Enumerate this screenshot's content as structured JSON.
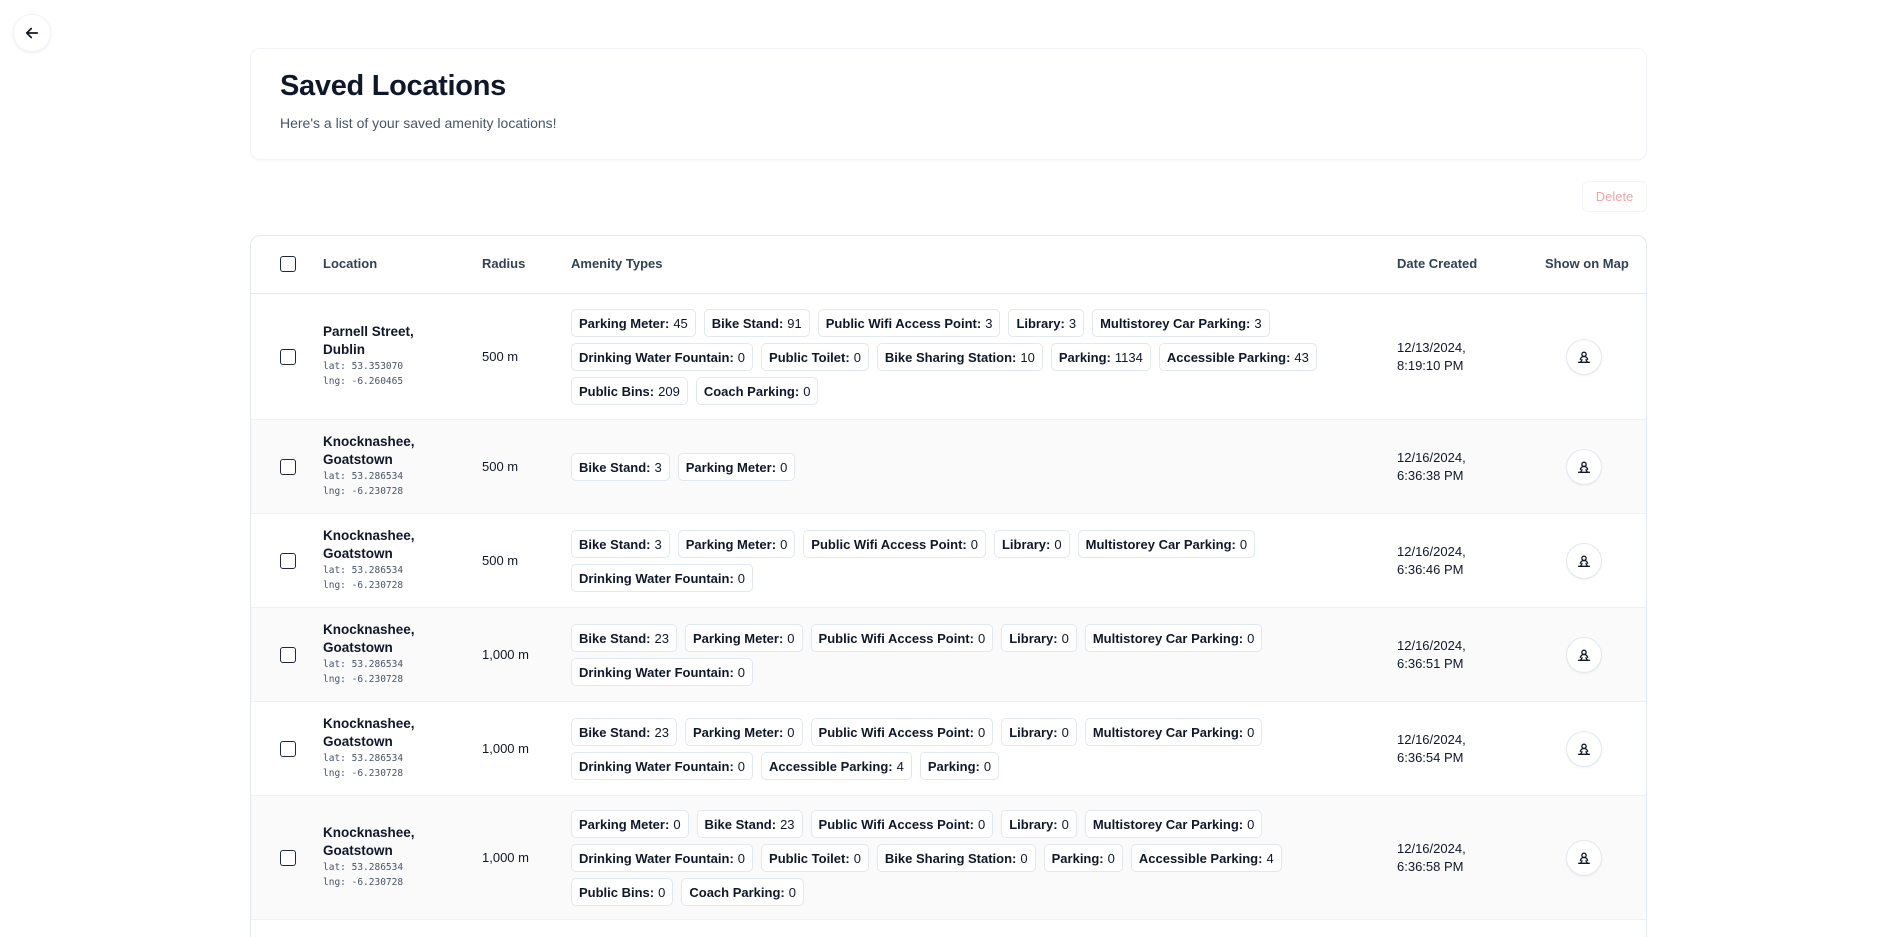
{
  "header": {
    "title": "Saved Locations",
    "subtitle": "Here's a list of your saved amenity locations!"
  },
  "actions": {
    "delete_label": "Delete"
  },
  "table": {
    "columns": [
      "Location",
      "Radius",
      "Amenity Types",
      "Date Created",
      "Show on Map"
    ],
    "rows": [
      {
        "name": "Parnell Street, Dublin",
        "lat": "lat: 53.353070",
        "lng": "lng: -6.260465",
        "radius": "500 m",
        "amenities": [
          {
            "k": "Parking Meter:",
            "v": "45"
          },
          {
            "k": "Bike Stand:",
            "v": "91"
          },
          {
            "k": "Public Wifi Access Point:",
            "v": "3"
          },
          {
            "k": "Library:",
            "v": "3"
          },
          {
            "k": "Multistorey Car Parking:",
            "v": "3"
          },
          {
            "k": "Drinking Water Fountain:",
            "v": "0"
          },
          {
            "k": "Public Toilet:",
            "v": "0"
          },
          {
            "k": "Bike Sharing Station:",
            "v": "10"
          },
          {
            "k": "Parking:",
            "v": "1134"
          },
          {
            "k": "Accessible Parking:",
            "v": "43"
          },
          {
            "k": "Public Bins:",
            "v": "209"
          },
          {
            "k": "Coach Parking:",
            "v": "0"
          }
        ],
        "date": "12/13/2024,",
        "time": "8:19:10 PM"
      },
      {
        "name": "Knocknashee, Goatstown",
        "lat": "lat: 53.286534",
        "lng": "lng: -6.230728",
        "radius": "500 m",
        "amenities": [
          {
            "k": "Bike Stand:",
            "v": "3"
          },
          {
            "k": "Parking Meter:",
            "v": "0"
          }
        ],
        "date": "12/16/2024,",
        "time": "6:36:38 PM"
      },
      {
        "name": "Knocknashee, Goatstown",
        "lat": "lat: 53.286534",
        "lng": "lng: -6.230728",
        "radius": "500 m",
        "amenities": [
          {
            "k": "Bike Stand:",
            "v": "3"
          },
          {
            "k": "Parking Meter:",
            "v": "0"
          },
          {
            "k": "Public Wifi Access Point:",
            "v": "0"
          },
          {
            "k": "Library:",
            "v": "0"
          },
          {
            "k": "Multistorey Car Parking:",
            "v": "0"
          },
          {
            "k": "Drinking Water Fountain:",
            "v": "0"
          }
        ],
        "date": "12/16/2024,",
        "time": "6:36:46 PM"
      },
      {
        "name": "Knocknashee, Goatstown",
        "lat": "lat: 53.286534",
        "lng": "lng: -6.230728",
        "radius": "1,000 m",
        "amenities": [
          {
            "k": "Bike Stand:",
            "v": "23"
          },
          {
            "k": "Parking Meter:",
            "v": "0"
          },
          {
            "k": "Public Wifi Access Point:",
            "v": "0"
          },
          {
            "k": "Library:",
            "v": "0"
          },
          {
            "k": "Multistorey Car Parking:",
            "v": "0"
          },
          {
            "k": "Drinking Water Fountain:",
            "v": "0"
          }
        ],
        "date": "12/16/2024,",
        "time": "6:36:51 PM"
      },
      {
        "name": "Knocknashee, Goatstown",
        "lat": "lat: 53.286534",
        "lng": "lng: -6.230728",
        "radius": "1,000 m",
        "amenities": [
          {
            "k": "Bike Stand:",
            "v": "23"
          },
          {
            "k": "Parking Meter:",
            "v": "0"
          },
          {
            "k": "Public Wifi Access Point:",
            "v": "0"
          },
          {
            "k": "Library:",
            "v": "0"
          },
          {
            "k": "Multistorey Car Parking:",
            "v": "0"
          },
          {
            "k": "Drinking Water Fountain:",
            "v": "0"
          },
          {
            "k": "Accessible Parking:",
            "v": "4"
          },
          {
            "k": "Parking:",
            "v": "0"
          }
        ],
        "date": "12/16/2024,",
        "time": "6:36:54 PM"
      },
      {
        "name": "Knocknashee, Goatstown",
        "lat": "lat: 53.286534",
        "lng": "lng: -6.230728",
        "radius": "1,000 m",
        "amenities": [
          {
            "k": "Parking Meter:",
            "v": "0"
          },
          {
            "k": "Bike Stand:",
            "v": "23"
          },
          {
            "k": "Public Wifi Access Point:",
            "v": "0"
          },
          {
            "k": "Library:",
            "v": "0"
          },
          {
            "k": "Multistorey Car Parking:",
            "v": "0"
          },
          {
            "k": "Drinking Water Fountain:",
            "v": "0"
          },
          {
            "k": "Public Toilet:",
            "v": "0"
          },
          {
            "k": "Bike Sharing Station:",
            "v": "0"
          },
          {
            "k": "Parking:",
            "v": "0"
          },
          {
            "k": "Accessible Parking:",
            "v": "4"
          },
          {
            "k": "Public Bins:",
            "v": "0"
          },
          {
            "k": "Coach Parking:",
            "v": "0"
          }
        ],
        "date": "12/16/2024,",
        "time": "6:36:58 PM"
      }
    ]
  },
  "icons": {
    "back": "arrow-left-icon",
    "map": "map-pin-user-icon"
  },
  "colors": {
    "delete_text": "#f2a5a5",
    "border": "#e2e8f0",
    "title": "#0f172a"
  }
}
